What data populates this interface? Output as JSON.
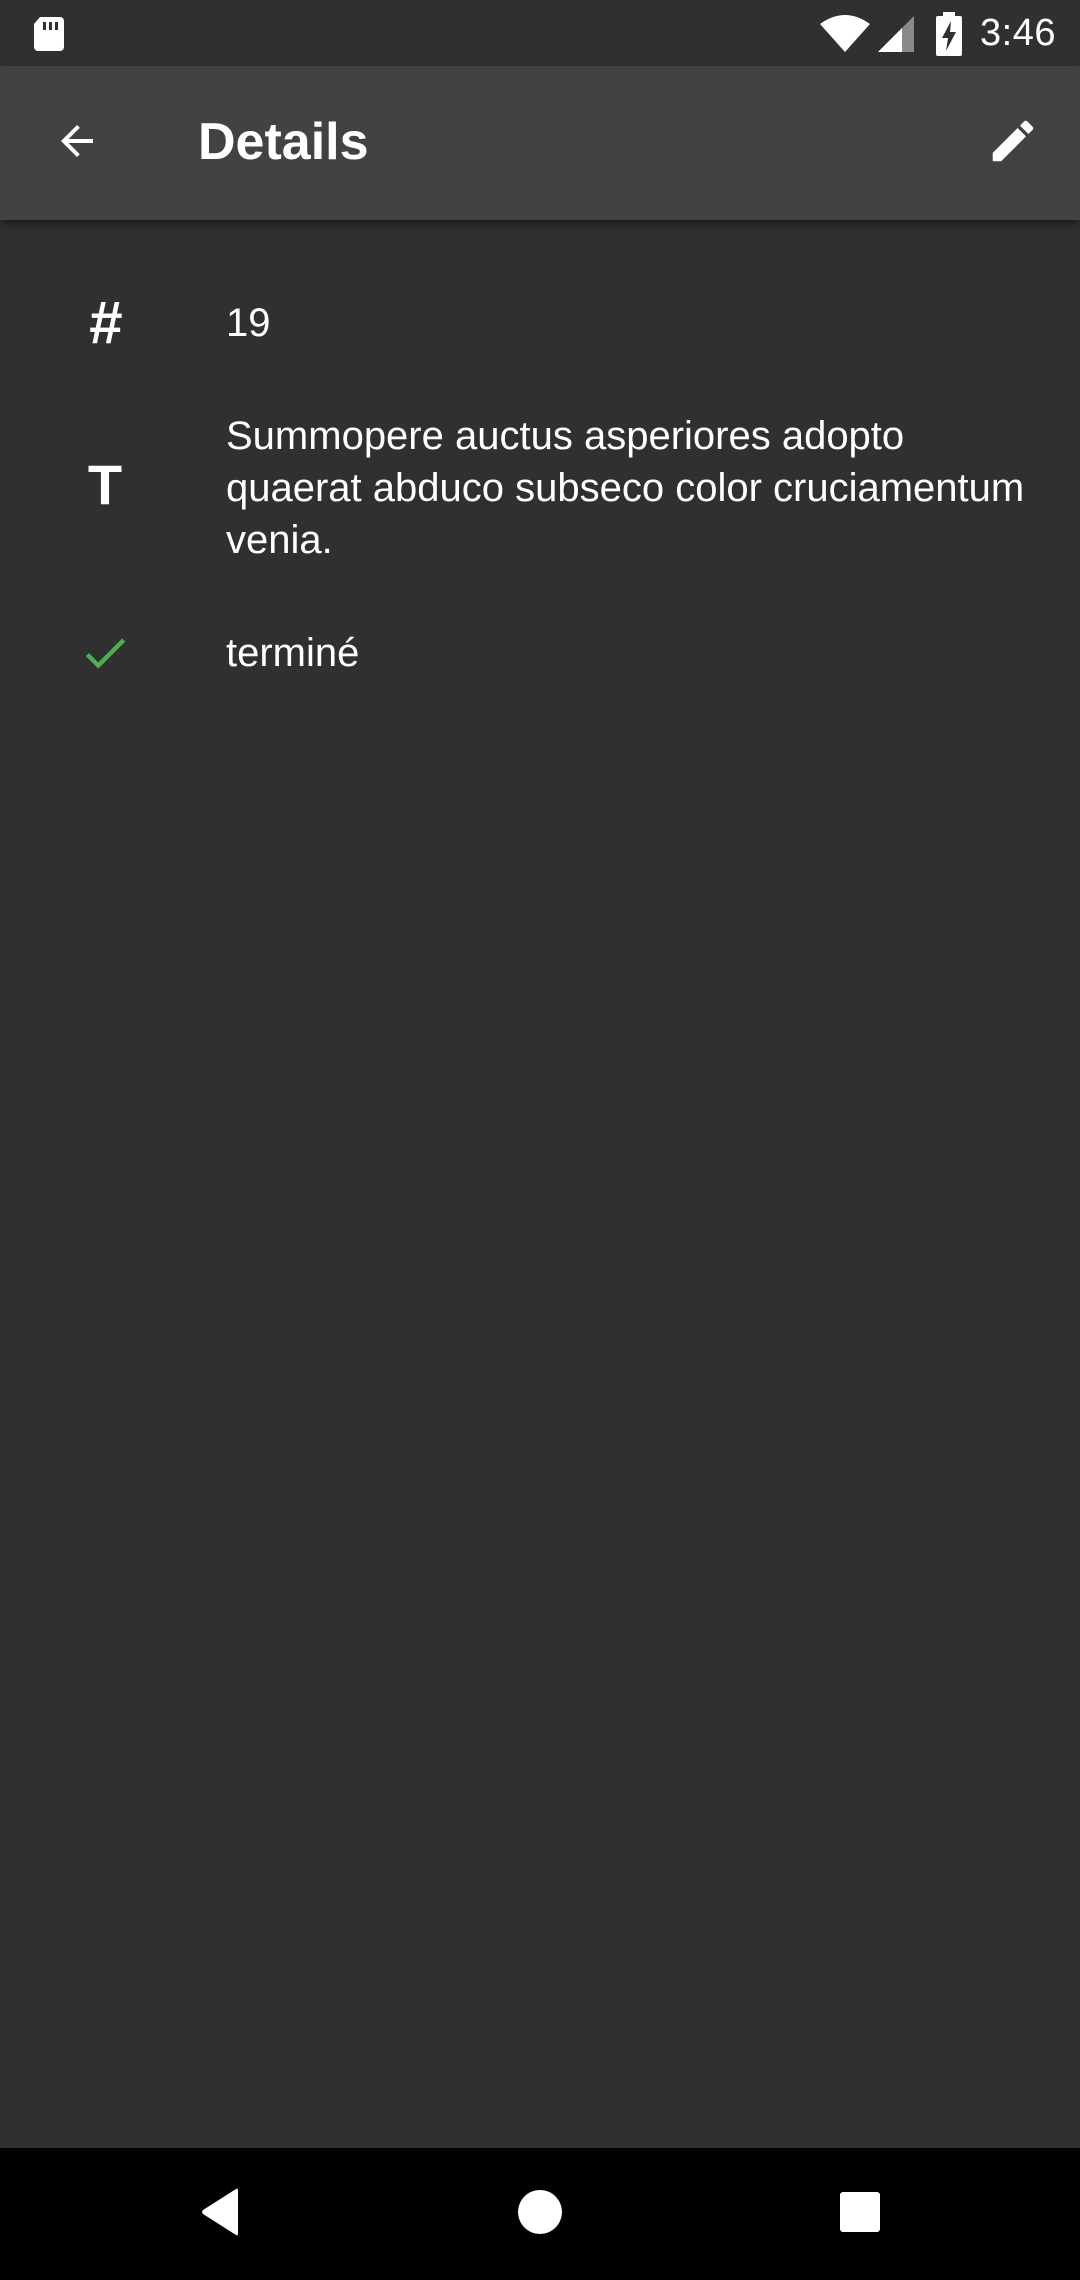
{
  "status_bar": {
    "time": "3:46",
    "icons": [
      "sd-card-icon",
      "wifi-icon",
      "cell-signal-icon",
      "battery-charging-icon"
    ]
  },
  "app_bar": {
    "title": "Details",
    "back_icon": "arrow-back-icon",
    "edit_icon": "pencil-icon"
  },
  "details": {
    "number": "19",
    "text": "Summopere auctus asperiores adopto quaerat abduco subseco color cruciamentum venia.",
    "status": "terminé"
  },
  "nav_bar": {
    "icons": [
      "back-triangle-icon",
      "home-circle-icon",
      "recents-square-icon"
    ]
  },
  "colors": {
    "background": "#303030",
    "app_bar": "#424242",
    "status_check": "#4caf50",
    "nav_bar": "#000000",
    "text": "#ffffff"
  }
}
